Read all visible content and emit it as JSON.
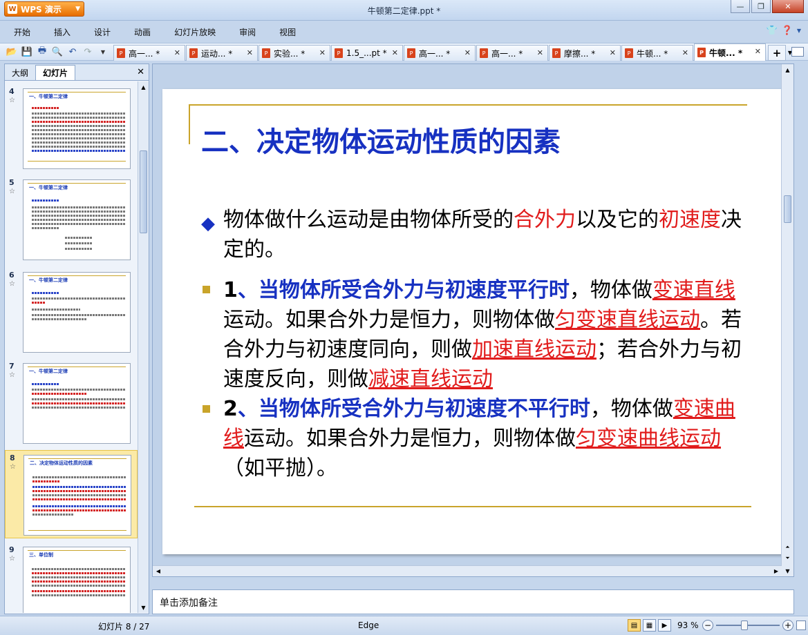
{
  "app": {
    "name": "WPS 演示",
    "window_title": "牛顿第二定律.ppt *"
  },
  "menu": [
    "开始",
    "插入",
    "设计",
    "动画",
    "幻灯片放映",
    "审阅",
    "视图"
  ],
  "tabs": [
    {
      "label": "高一... *"
    },
    {
      "label": "运动... *"
    },
    {
      "label": "实验... *"
    },
    {
      "label": "1.5_...pt *"
    },
    {
      "label": "高一... *"
    },
    {
      "label": "高一... *"
    },
    {
      "label": "摩擦... *"
    },
    {
      "label": "牛顿... *"
    },
    {
      "label": "牛顿... *",
      "active": true
    }
  ],
  "left_panel": {
    "tab_outline": "大纲",
    "tab_slides": "幻灯片",
    "thumbnails": [
      {
        "num": "4",
        "title": "一、牛顿第二定律"
      },
      {
        "num": "5",
        "title": "一、牛顿第二定律"
      },
      {
        "num": "6",
        "title": "一、牛顿第二定律"
      },
      {
        "num": "7",
        "title": "一、牛顿第二定律"
      },
      {
        "num": "8",
        "title": "二、决定物体运动性质的因素",
        "selected": true
      },
      {
        "num": "9",
        "title": "三、单位制"
      }
    ]
  },
  "slide": {
    "title": "二、决定物体运动性质的因素",
    "p1": {
      "a": "物体做什么运动是由物体所受的",
      "b": "合外力",
      "c": "以及它的",
      "d": "初速度",
      "e": "决定的。"
    },
    "p2": {
      "num": "1",
      "lead": "、当物体所受合外力与初速度平行时",
      "t1": "，物体做",
      "u1": "变速直线",
      "t2": "运动。如果合外力是恒力，则物体做",
      "u2": "匀变速直线运动",
      "t3": "。若合外力与初速度同向，则做",
      "u3": "加速直线运动",
      "t4": "；若合外力与初速度反向，则做",
      "u4": "减速直线运动"
    },
    "p3": {
      "num": "2",
      "lead": "、当物体所受合外力与初速度不平行时",
      "t1": "，物体做",
      "u1": "变速曲线",
      "t2": "运动。如果合外力是恒力，则物体做",
      "u2": "匀变速曲线运动",
      "t3": "（如平抛）。"
    }
  },
  "notes": {
    "placeholder": "单击添加备注"
  },
  "status": {
    "slide_indicator": "幻灯片 8 / 27",
    "theme": "Edge",
    "zoom": "93 %"
  }
}
